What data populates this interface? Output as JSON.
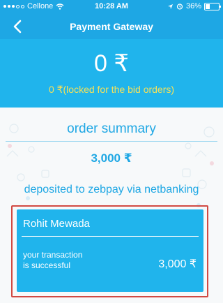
{
  "status_bar": {
    "carrier": "Cellone",
    "time": "10:28 AM",
    "battery": "36%",
    "battery_level": 0.36
  },
  "nav": {
    "title": "Payment Gateway"
  },
  "balance": {
    "amount": "0 ₹",
    "locked_text": "0 ₹(locked for the bid orders)"
  },
  "summary": {
    "title": "order summary",
    "amount": "3,000 ₹",
    "deposit_label": "deposited to zebpay via netbanking"
  },
  "transaction": {
    "name": "Rohit Mewada",
    "status_line1": "your transaction",
    "status_line2": "is successful",
    "amount": "3,000 ₹"
  },
  "icons": [
    "signal-dots-icon",
    "wifi-icon",
    "location-icon",
    "alarm-icon",
    "battery-icon",
    "back-chevron-icon"
  ],
  "colors": {
    "primary": "#1ea7e4",
    "panel": "#20b4ec",
    "locked_text": "#f4e15a",
    "highlight_border": "#d14a43"
  }
}
